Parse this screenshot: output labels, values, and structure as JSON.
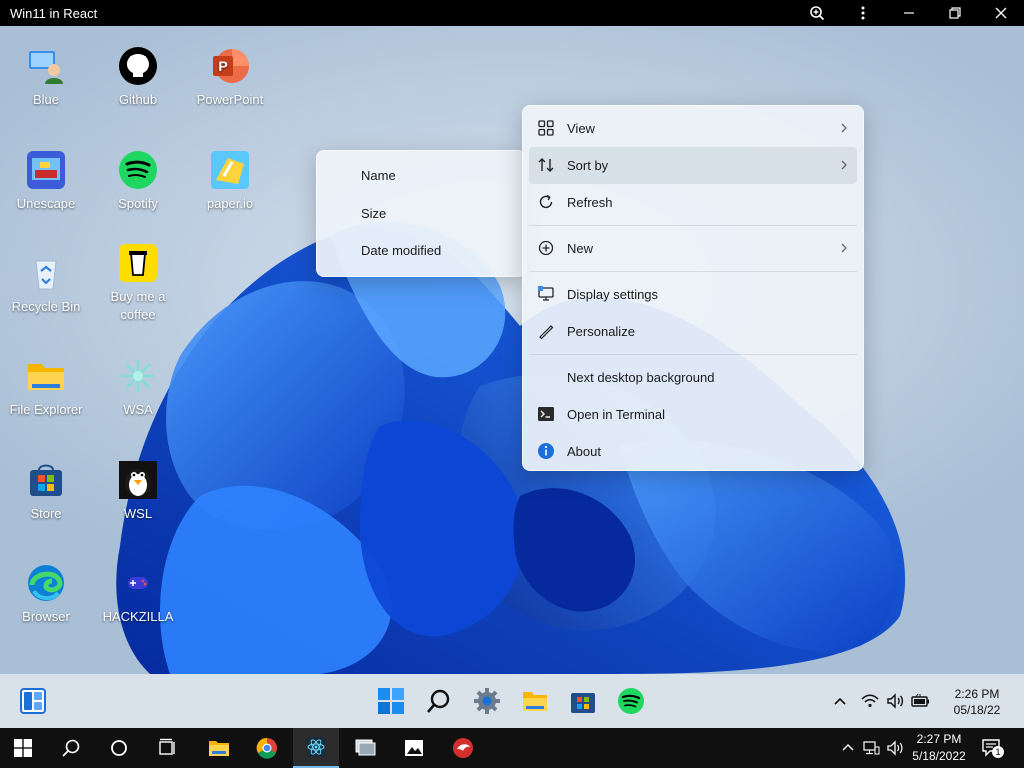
{
  "window": {
    "title": "Win11 in React"
  },
  "desktop": {
    "icons": [
      {
        "label": "Blue",
        "icon": "blue-user-icon"
      },
      {
        "label": "Github",
        "icon": "github-icon"
      },
      {
        "label": "PowerPoint",
        "icon": "powerpoint-icon"
      },
      {
        "label": "Unescape",
        "icon": "unescape-icon"
      },
      {
        "label": "Spotify",
        "icon": "spotify-icon"
      },
      {
        "label": "paper.io",
        "icon": "paper-io-icon"
      },
      {
        "label": "Recycle Bin",
        "icon": "recycle-bin-icon"
      },
      {
        "label": "Buy me a coffee",
        "icon": "coffee-icon"
      },
      {
        "label": "File Explorer",
        "icon": "folder-icon"
      },
      {
        "label": "WSA",
        "icon": "wsa-icon"
      },
      {
        "label": "Store",
        "icon": "store-icon"
      },
      {
        "label": "WSL",
        "icon": "penguin-icon"
      },
      {
        "label": "Browser",
        "icon": "edge-icon"
      },
      {
        "label": "HACKZILLA",
        "icon": "gamepad-icon"
      }
    ]
  },
  "context_menu": {
    "items": [
      {
        "label": "View",
        "icon": "grid-icon",
        "submenu": true
      },
      {
        "label": "Sort by",
        "icon": "sort-icon",
        "submenu": true
      },
      {
        "label": "Refresh",
        "icon": "refresh-icon",
        "submenu": false
      },
      {
        "label": "New",
        "icon": "plus-circle-icon",
        "submenu": true
      },
      {
        "label": "Display settings",
        "icon": "display-icon",
        "submenu": false
      },
      {
        "label": "Personalize",
        "icon": "pen-icon",
        "submenu": false
      },
      {
        "label": "Next desktop background",
        "icon": "",
        "submenu": false
      },
      {
        "label": "Open in Terminal",
        "icon": "terminal-icon",
        "submenu": false
      },
      {
        "label": "About",
        "icon": "info-icon",
        "submenu": false
      }
    ]
  },
  "sort_menu": {
    "items": [
      {
        "label": "Name"
      },
      {
        "label": "Size"
      },
      {
        "label": "Date modified"
      }
    ]
  },
  "w11_taskbar": {
    "clock": {
      "time": "2:26 PM",
      "date": "05/18/22"
    }
  },
  "host_taskbar": {
    "clock": {
      "time": "2:27 PM",
      "date": "5/18/2022"
    },
    "notification_count": "1"
  },
  "colors": {
    "accent": "#1a6fd8",
    "menu_bg": "#eef3f9",
    "wallpaper_blue": "#1e6cf0"
  }
}
